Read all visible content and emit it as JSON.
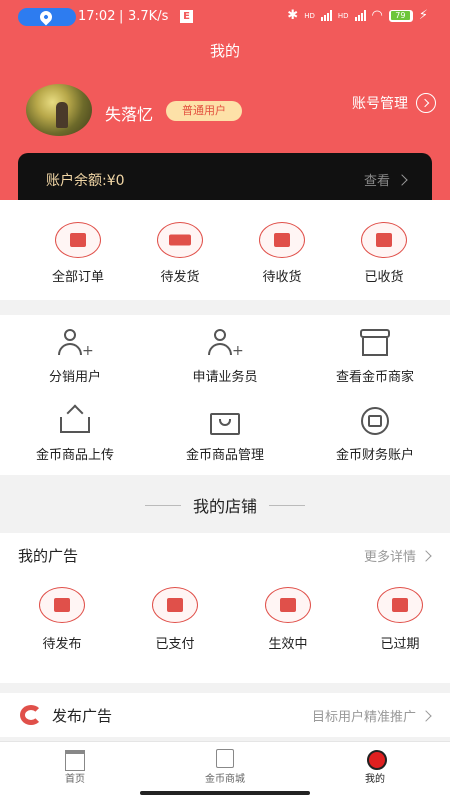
{
  "status_bar": {
    "time": "17:02",
    "separator": "|",
    "speed": "3.7K/s",
    "e_icon": "E",
    "hd1": "HD",
    "hd2": "HD",
    "battery": "79"
  },
  "header": {
    "title": "我的",
    "username": "失落忆",
    "user_badge": "普通用户",
    "account_manage": "账号管理",
    "balance_label": "账户余额:¥0",
    "balance_view": "查看"
  },
  "orders": [
    {
      "label": "全部订单",
      "icon": "order-list-icon"
    },
    {
      "label": "待发货",
      "icon": "truck-icon"
    },
    {
      "label": "待收货",
      "icon": "receive-icon"
    },
    {
      "label": "已收货",
      "icon": "check-bag-icon"
    }
  ],
  "services": [
    {
      "label": "分销用户",
      "icon": "person-plus-icon"
    },
    {
      "label": "申请业务员",
      "icon": "people-plus-icon"
    },
    {
      "label": "查看金币商家",
      "icon": "store-icon"
    },
    {
      "label": "金币商品上传",
      "icon": "upload-icon"
    },
    {
      "label": "金币商品管理",
      "icon": "bag-icon"
    },
    {
      "label": "金币财务账户",
      "icon": "coin-account-icon"
    }
  ],
  "shop": {
    "title": "我的店铺"
  },
  "ads": {
    "title": "我的广告",
    "more": "更多详情",
    "items": [
      {
        "label": "待发布",
        "icon": "yen-icon"
      },
      {
        "label": "已支付",
        "icon": "card-icon"
      },
      {
        "label": "生效中",
        "icon": "lifebuoy-icon"
      },
      {
        "label": "已过期",
        "icon": "calendar-icon"
      }
    ]
  },
  "publish": {
    "label": "发布广告",
    "right": "目标用户精准推广"
  },
  "tabbar": [
    {
      "label": "首页",
      "icon": "home-icon"
    },
    {
      "label": "金币商城",
      "icon": "mall-icon"
    },
    {
      "label": "我的",
      "icon": "mine-icon"
    }
  ],
  "colors": {
    "accent": "#f25a5a",
    "balance_text": "#f2d7a6",
    "badge_bg": "#fde1a8"
  }
}
